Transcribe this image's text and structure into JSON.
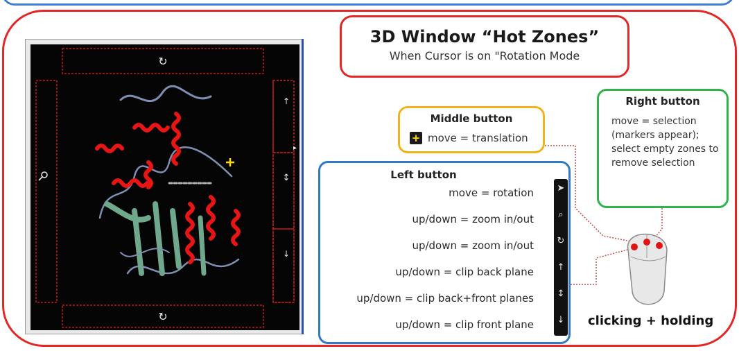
{
  "title": {
    "main": "3D Window “Hot Zones”",
    "sub": "When Cursor is on \"Rotation Mode"
  },
  "middle_button": {
    "heading": "Middle button",
    "text": "move = translation",
    "icon": "plus-icon"
  },
  "right_button": {
    "heading": "Right button",
    "text": "move = selection (markers appear); select empty zones to remove selection"
  },
  "left_button": {
    "heading": "Left button",
    "rows": [
      {
        "text": "move = rotation",
        "icon": "cursor-arrow-icon"
      },
      {
        "text": "up/down = zoom in/out",
        "icon": "magnifier-icon"
      },
      {
        "text": "up/down = zoom in/out",
        "icon": "rotate-arrows-icon"
      },
      {
        "text": "up/down = clip back plane",
        "icon": "clip-back-icon"
      },
      {
        "text": "up/down = clip back+front planes",
        "icon": "clip-both-icon"
      },
      {
        "text": "up/down = clip front plane",
        "icon": "clip-front-icon"
      }
    ]
  },
  "caption": "clicking + holding",
  "colors": {
    "frame_red": "#e32727",
    "frame_blue": "#3c7fd2",
    "middle_border": "#f0b21e",
    "right_border": "#2fb34a",
    "left_border": "#2f79c6",
    "zone_lines": "#c21a1a",
    "helix": "#e81515",
    "sheet": "#6fa88c",
    "coil": "#7f8fb4"
  }
}
